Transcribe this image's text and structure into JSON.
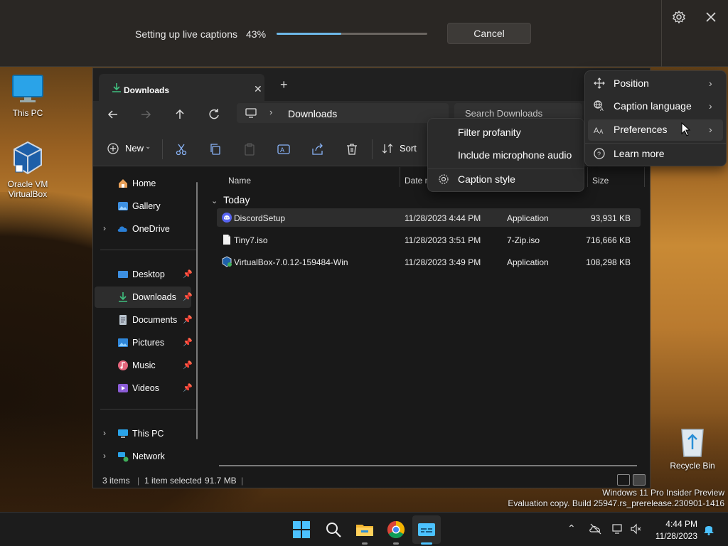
{
  "live_captions": {
    "status": "Setting up live captions",
    "percent": "43%",
    "progress": 0.43,
    "cancel_label": "Cancel",
    "settings_icon": "gear-icon",
    "close_icon": "close-icon"
  },
  "desktop_icons": [
    {
      "label": "This PC",
      "icon": "monitor-icon"
    },
    {
      "label": "Oracle VM VirtualBox",
      "icon": "virtualbox-icon"
    },
    {
      "label": "Recycle Bin",
      "icon": "recycle-bin-icon"
    }
  ],
  "explorer": {
    "tab_title": "Downloads",
    "tab_close": "✕",
    "tab_add": "+",
    "breadcrumb": "Downloads",
    "search_placeholder": "Search Downloads",
    "toolbar": {
      "new_label": "New",
      "sort_label": "Sort"
    },
    "sidebar": {
      "items": [
        {
          "label": "Home",
          "icon": "home-icon"
        },
        {
          "label": "Gallery",
          "icon": "gallery-icon"
        },
        {
          "label": "OneDrive",
          "icon": "cloud-icon"
        },
        {
          "label": "Desktop",
          "icon": "desktop-icon"
        },
        {
          "label": "Downloads",
          "icon": "download-icon"
        },
        {
          "label": "Documents",
          "icon": "documents-icon"
        },
        {
          "label": "Pictures",
          "icon": "pictures-icon"
        },
        {
          "label": "Music",
          "icon": "music-icon"
        },
        {
          "label": "Videos",
          "icon": "videos-icon"
        },
        {
          "label": "This PC",
          "icon": "computer-icon"
        },
        {
          "label": "Network",
          "icon": "network-icon"
        }
      ],
      "selected": "Downloads"
    },
    "columns": {
      "name": "Name",
      "date": "Date m",
      "size": "Size"
    },
    "group": "Today",
    "files": [
      {
        "name": "DiscordSetup",
        "date": "11/28/2023 4:44 PM",
        "type": "Application",
        "size": "93,931 KB",
        "icon": "discord-icon"
      },
      {
        "name": "Tiny7.iso",
        "date": "11/28/2023 3:51 PM",
        "type": "7-Zip.iso",
        "size": "716,666 KB",
        "icon": "file-icon"
      },
      {
        "name": "VirtualBox-7.0.12-159484-Win",
        "date": "11/28/2023 3:49 PM",
        "type": "Application",
        "size": "108,298 KB",
        "icon": "virtualbox-installer-icon"
      }
    ],
    "status": {
      "count": "3 items",
      "selection": "1 item selected",
      "selection_size": "91.7 MB"
    }
  },
  "captions_menu": {
    "items": [
      {
        "label": "Position",
        "icon": "move-icon"
      },
      {
        "label": "Caption language",
        "icon": "language-icon"
      },
      {
        "label": "Preferences",
        "icon": "text-size-icon"
      },
      {
        "label": "Learn more",
        "icon": "help-icon"
      }
    ]
  },
  "preferences_submenu": {
    "items": [
      {
        "label": "Filter profanity"
      },
      {
        "label": "Include microphone audio"
      },
      {
        "label": "Caption style",
        "icon": "gear-icon"
      }
    ]
  },
  "watermark": {
    "line1": "Windows 11 Pro Insider Preview",
    "line2": "Evaluation copy. Build 25947.rs_prerelease.230901-1416"
  },
  "taskbar": {
    "time": "4:44 PM",
    "date": "11/28/2023",
    "apps": [
      "windows-start-icon",
      "search-icon",
      "file-explorer-icon",
      "chrome-icon",
      "live-captions-icon"
    ]
  },
  "colors": {
    "accent": "#6db8e8",
    "window_bg": "#191919",
    "menu_bg": "#2b2b2b"
  }
}
